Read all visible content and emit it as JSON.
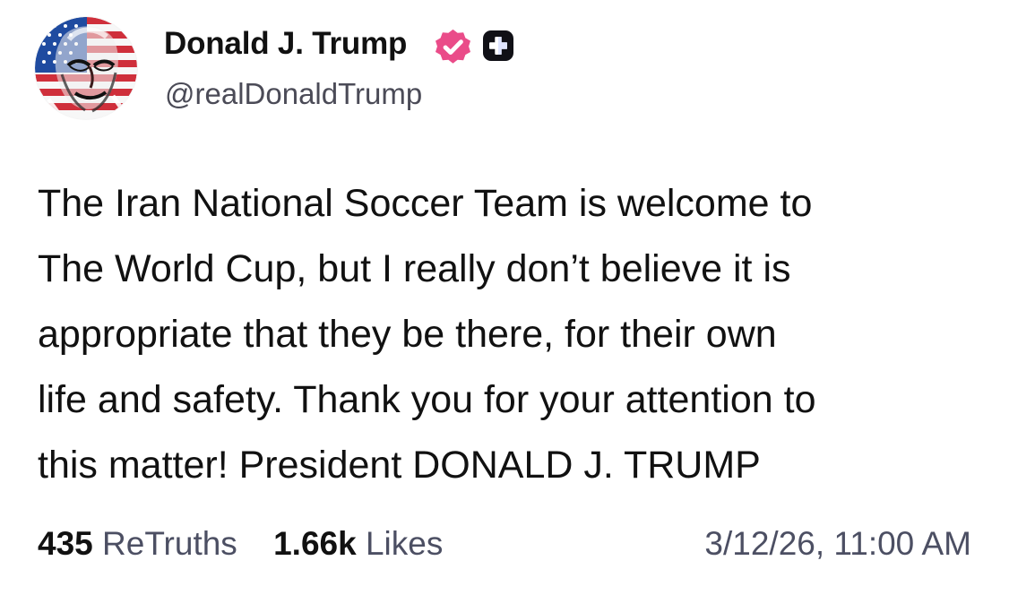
{
  "post": {
    "author": {
      "display_name": "Donald J. Trump",
      "handle": "@realDonaldTrump",
      "avatar_icon": "flag-portrait-avatar",
      "verified_icon": "verified-badge-icon",
      "verified_color": "#ea4c89",
      "plus_icon": "plus-badge-icon"
    },
    "text": "The Iran National Soccer Team is welcome to\nThe World Cup, but I really don’t believe it is\nappropriate that they be there, for their own\nlife and safety. Thank you for your attention to\nthis matter! President DONALD J. TRUMP",
    "stats": {
      "retruths_count": "435",
      "retruths_label": "ReTruths",
      "likes_count": "1.66k",
      "likes_label": "Likes"
    },
    "timestamp": "3/12/26, 11:00 AM"
  }
}
